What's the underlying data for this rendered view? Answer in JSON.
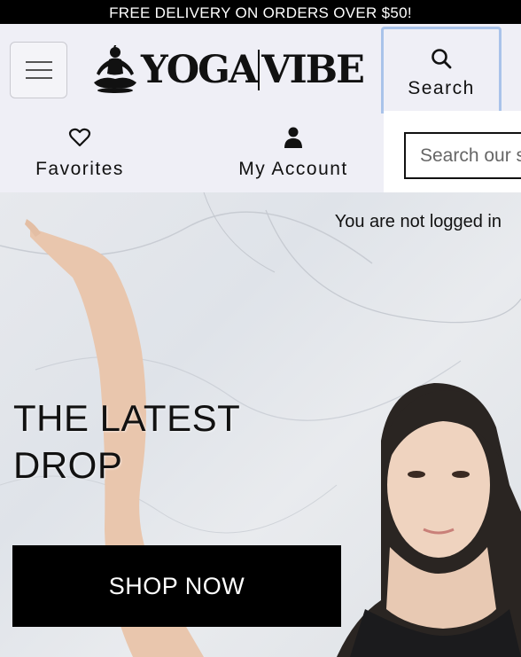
{
  "promo": {
    "text": "FREE DELIVERY ON ORDERS OVER $50!"
  },
  "header": {
    "menu_icon": "hamburger-menu-icon",
    "logo": {
      "icon": "meditating-figure-icon",
      "text_left": "YOGA",
      "text_right": "VIBE"
    },
    "search": {
      "label": "Search",
      "icon": "search-icon",
      "placeholder": "Search our store"
    },
    "nav": {
      "favorites": {
        "label": "Favorites",
        "icon": "heart-icon"
      },
      "account": {
        "label": "My Account",
        "icon": "user-icon"
      }
    }
  },
  "hero": {
    "login_status": "You are not logged in",
    "title_line1": "THE LATEST",
    "title_line2": "DROP",
    "cta_label": "SHOP NOW"
  },
  "colors": {
    "accent_focus": "#a9c3ea",
    "header_bg": "#efeff6",
    "button_bg": "#000000"
  }
}
